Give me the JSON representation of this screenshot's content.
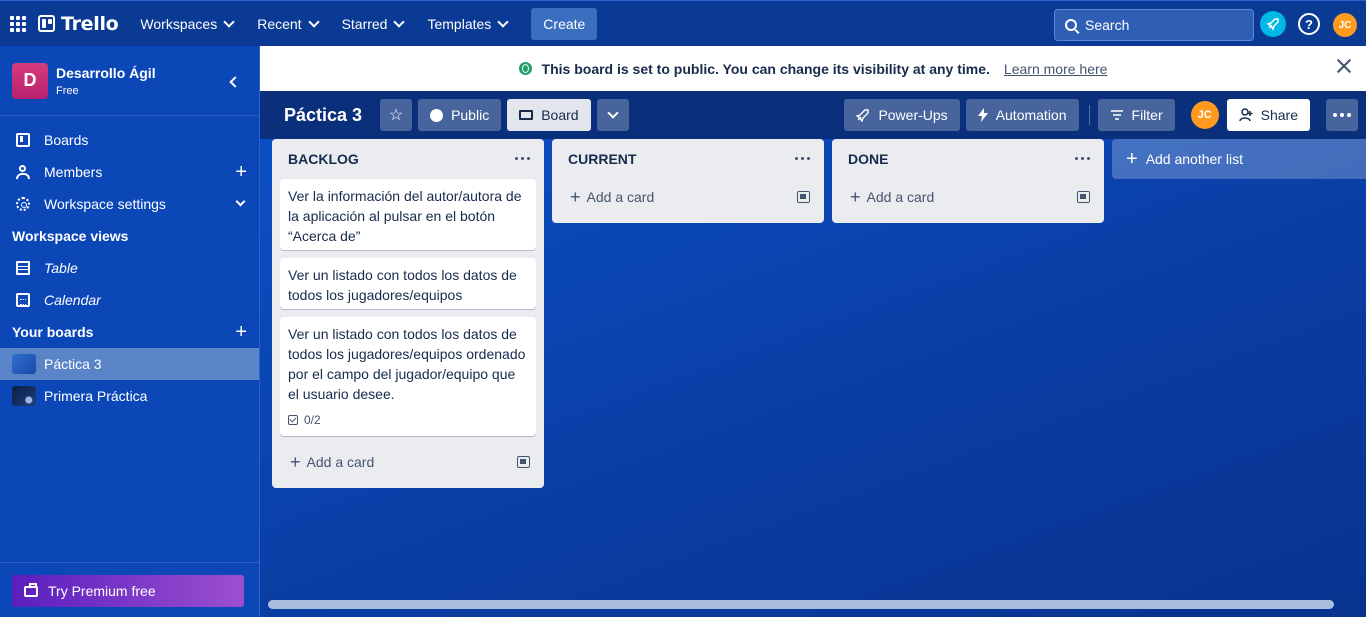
{
  "topnav": {
    "brand": "Trello",
    "menus": [
      "Workspaces",
      "Recent",
      "Starred",
      "Templates"
    ],
    "create_label": "Create",
    "search_placeholder": "Search",
    "avatar_initials": "JC"
  },
  "sidebar": {
    "workspace_initial": "D",
    "workspace_name": "Desarrollo Ágil",
    "workspace_plan": "Free",
    "items": [
      {
        "label": "Boards"
      },
      {
        "label": "Members"
      },
      {
        "label": "Workspace settings"
      }
    ],
    "views_heading": "Workspace views",
    "views": [
      {
        "label": "Table"
      },
      {
        "label": "Calendar"
      }
    ],
    "boards_heading": "Your boards",
    "boards": [
      {
        "label": "Páctica 3",
        "active": true
      },
      {
        "label": "Primera Práctica",
        "active": false
      }
    ],
    "premium_label": "Try Premium free"
  },
  "banner": {
    "text": "This board is set to public. You can change its visibility at any time.",
    "link": "Learn more here"
  },
  "board_header": {
    "title": "Páctica 3",
    "visibility_label": "Public",
    "view_label": "Board",
    "powerups_label": "Power-Ups",
    "automation_label": "Automation",
    "filter_label": "Filter",
    "avatar_initials": "JC",
    "share_label": "Share"
  },
  "lists": [
    {
      "title": "BACKLOG",
      "cards": [
        {
          "text": "Ver la información del autor/autora de la aplicación al pulsar en el botón “Acerca de”"
        },
        {
          "text": "Ver un listado con todos los datos de todos los jugadores/equipos"
        },
        {
          "text": "Ver un listado con todos los datos de todos los jugadores/equipos ordenado por el campo del jugador/equipo que el usuario desee.",
          "checklist": "0/2"
        }
      ],
      "add_label": "Add a card"
    },
    {
      "title": "CURRENT",
      "cards": [],
      "add_label": "Add a card"
    },
    {
      "title": "DONE",
      "cards": [],
      "add_label": "Add a card"
    }
  ],
  "add_list_label": "Add another list",
  "colors": {
    "nav": "#0a3a94",
    "sidebar": "#0c47b8",
    "accent_avatar": "#ff9a1f",
    "premium_start": "#5a1fbe",
    "public_green": "#22a06b"
  }
}
